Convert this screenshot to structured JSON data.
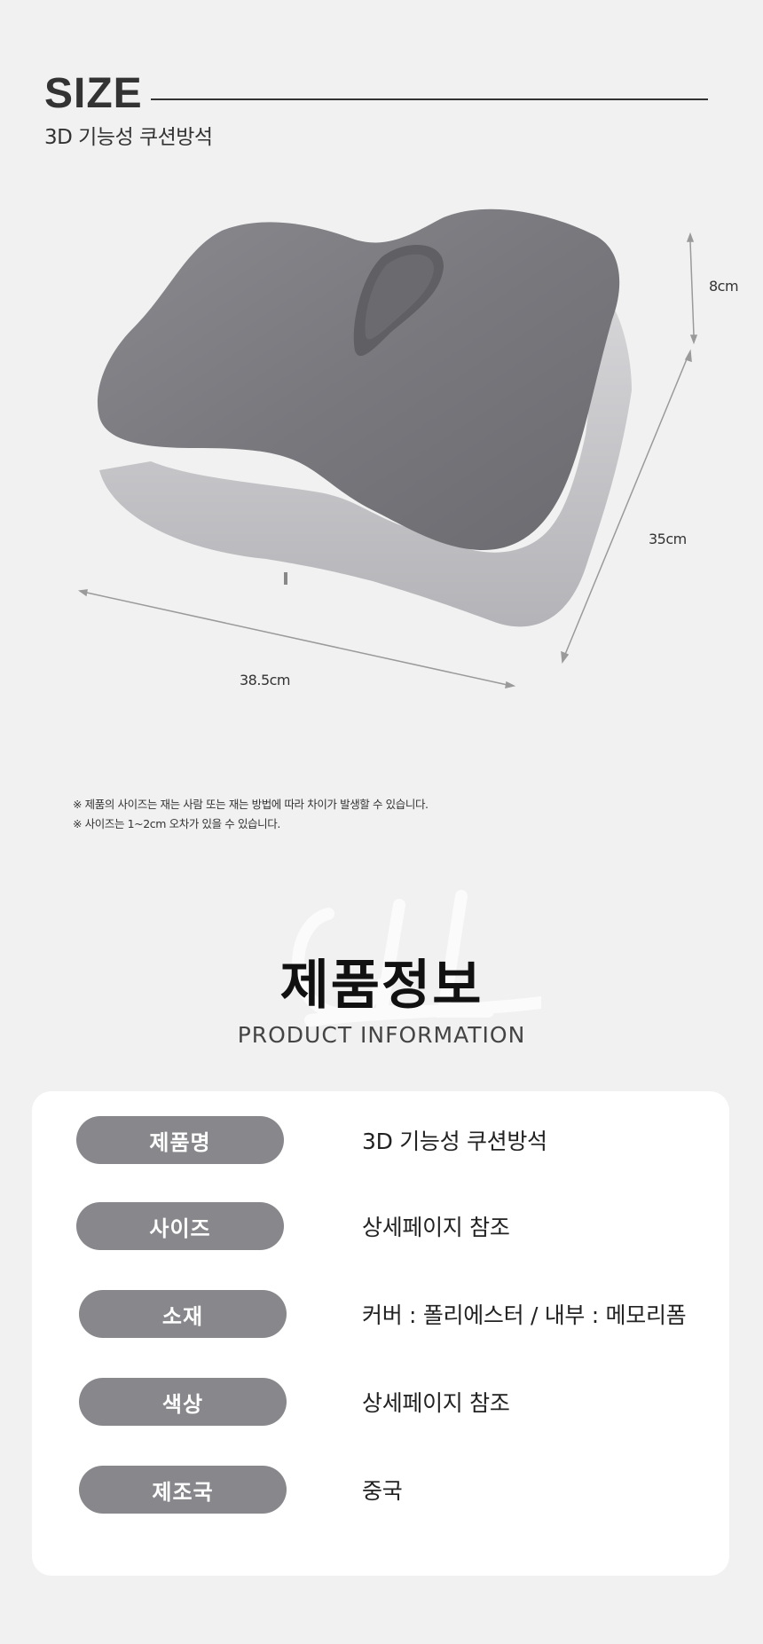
{
  "size_section": {
    "title": "SIZE",
    "subtitle": "3D 기능성 쿠션방석"
  },
  "dimensions": {
    "height": "8cm",
    "depth": "35cm",
    "width": "38.5cm"
  },
  "notes": [
    "※ 제품의 사이즈는 재는 사람 또는 재는 방법에 따라 차이가 발생할 수 있습니다.",
    "※ 사이즈는 1~2cm 오차가 있을 수 있습니다."
  ],
  "info_section": {
    "title": "제품정보",
    "subtitle": "PRODUCT INFORMATION"
  },
  "spec_rows": [
    {
      "label": "제품명",
      "value": "3D 기능성 쿠션방석"
    },
    {
      "label": "사이즈",
      "value": "상세페이지 참조"
    },
    {
      "label": "소재",
      "value": "커버 : 폴리에스터 / 내부 : 메모리폼"
    },
    {
      "label": "색상",
      "value": "상세페이지 참조"
    },
    {
      "label": "제조국",
      "value": "중국"
    }
  ],
  "colors": {
    "background": "#f1f1f1",
    "pill": "#87878c",
    "cushion_top": "#7b7b80",
    "cushion_side": "#c9c9cc"
  }
}
